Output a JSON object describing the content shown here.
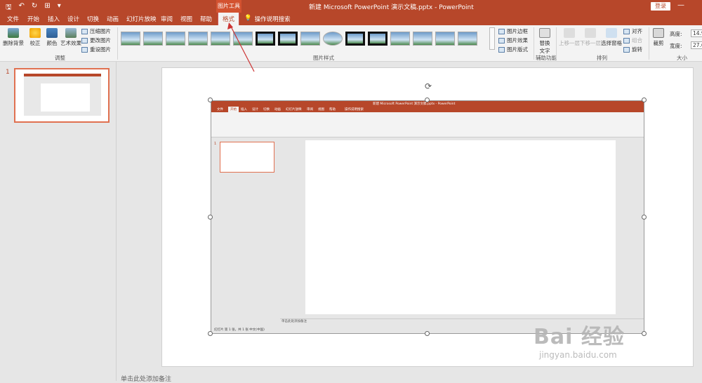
{
  "titlebar": {
    "qat": [
      "🖫",
      "↶",
      "↻",
      "⊞",
      "▾"
    ],
    "context_label": "图片工具",
    "doc_title": "新建 Microsoft PowerPoint 演示文稿.pptx  -  PowerPoint",
    "login_button": "登录",
    "window_buttons": [
      "▣",
      "—",
      "☐",
      "✕"
    ]
  },
  "tabs": [
    "文件",
    "开始",
    "插入",
    "设计",
    "切换",
    "动画",
    "幻灯片放映",
    "审阅",
    "视图",
    "帮助",
    "格式"
  ],
  "active_tab": "格式",
  "tellme": {
    "icon": "💡",
    "label": "操作说明搜索"
  },
  "ribbon": {
    "remove_bg": "删除背景",
    "correct": "校正",
    "color": "颜色",
    "art_effects": "艺术效果",
    "compress": "压缩图片",
    "change": "更改图片",
    "reset": "重设图片",
    "group_adjust": "调整",
    "group_styles": "图片样式",
    "picture_border": "图片边框",
    "picture_effects": "图片效果",
    "picture_layout": "图片版式",
    "alt_text_line1": "替换",
    "alt_text_line2": "文字",
    "group_accessibility": "辅助功能",
    "bring_forward": "上移一层",
    "send_backward": "下移一层",
    "selection_pane": "选择窗格",
    "align": "对齐",
    "group": "组合",
    "rotate": "旋转",
    "group_arrange": "排列",
    "crop": "裁剪",
    "height_label": "高度:",
    "height_value": "14.93",
    "width_label": "宽度:",
    "width_value": "27.62",
    "group_size": "大小"
  },
  "thumbnails": {
    "slide_number": "1"
  },
  "inner_screenshot": {
    "title": "新建 Microsoft PowerPoint 演示文稿.pptx - PowerPoint",
    "tabs": [
      "文件",
      "开始",
      "插入",
      "设计",
      "切换",
      "动画",
      "幻灯片放映",
      "审阅",
      "视图",
      "帮助",
      "操作说明搜索"
    ],
    "notes": "单击此处添加备注",
    "status": "幻灯片 第 1 张，共 1 张    中文(中国)",
    "slide_number": "1"
  },
  "notes_hint": "单击此处添加备注",
  "watermark": {
    "brand": "Bai 经验",
    "url": "jingyan.baidu.com"
  }
}
